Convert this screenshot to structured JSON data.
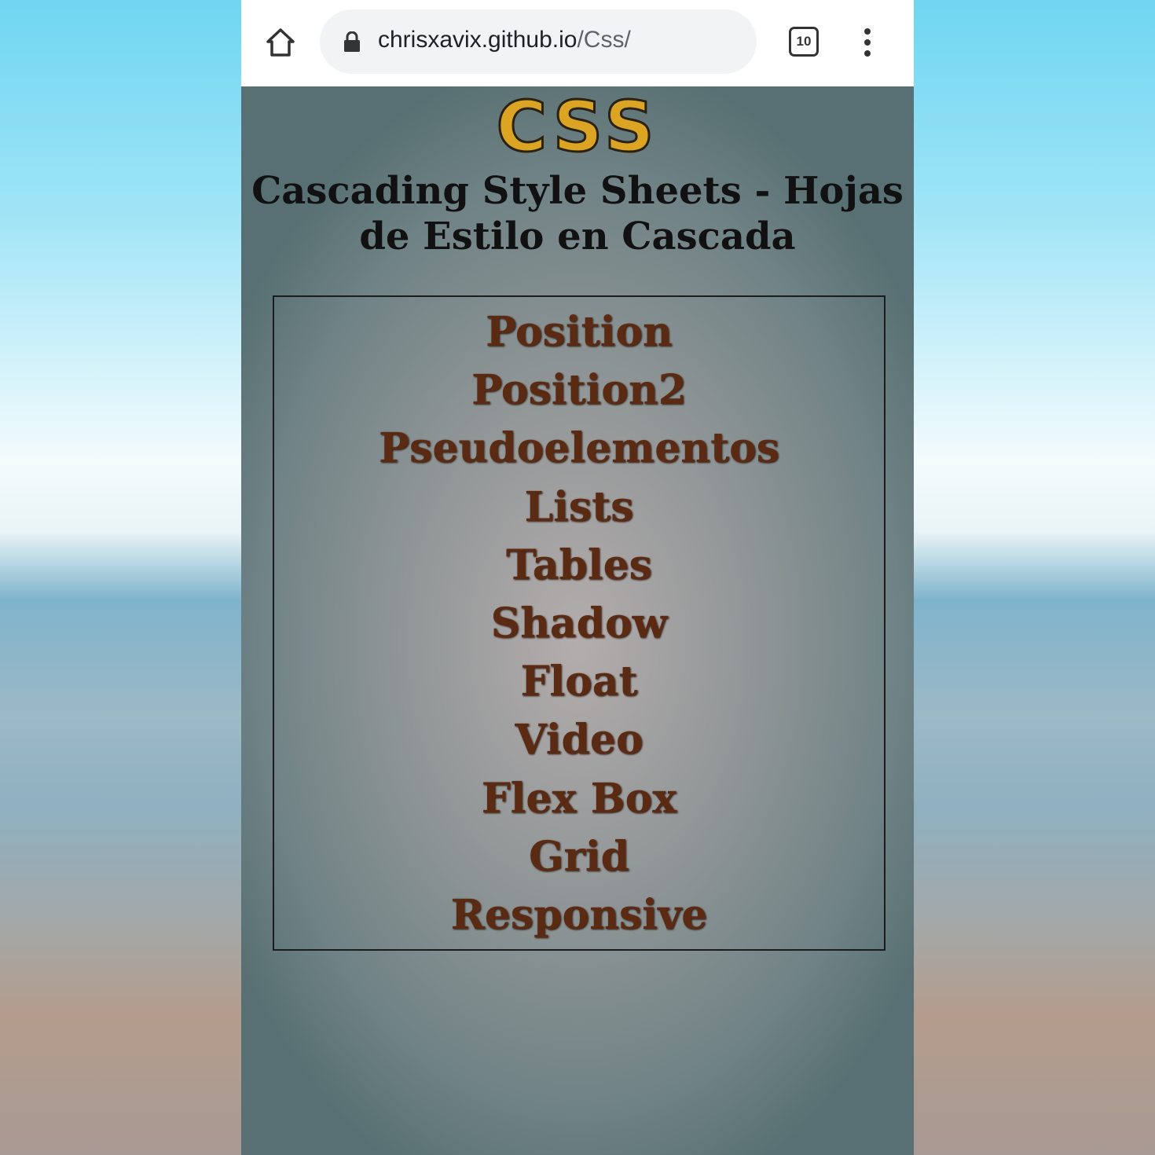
{
  "browser": {
    "url_domain": "chrisxavix.github.io",
    "url_path": "/Css/",
    "tab_count": "10"
  },
  "page": {
    "logo": "CSS",
    "subtitle": "Cascading Style Sheets - Hojas de Estilo en Cascada",
    "menu": [
      "Position",
      "Position2",
      "Pseudoelementos",
      "Lists",
      "Tables",
      "Shadow",
      "Float",
      "Video",
      "Flex Box",
      "Grid",
      "Responsive"
    ]
  },
  "colors": {
    "logo": "#dba423",
    "link": "#5b2a12"
  }
}
